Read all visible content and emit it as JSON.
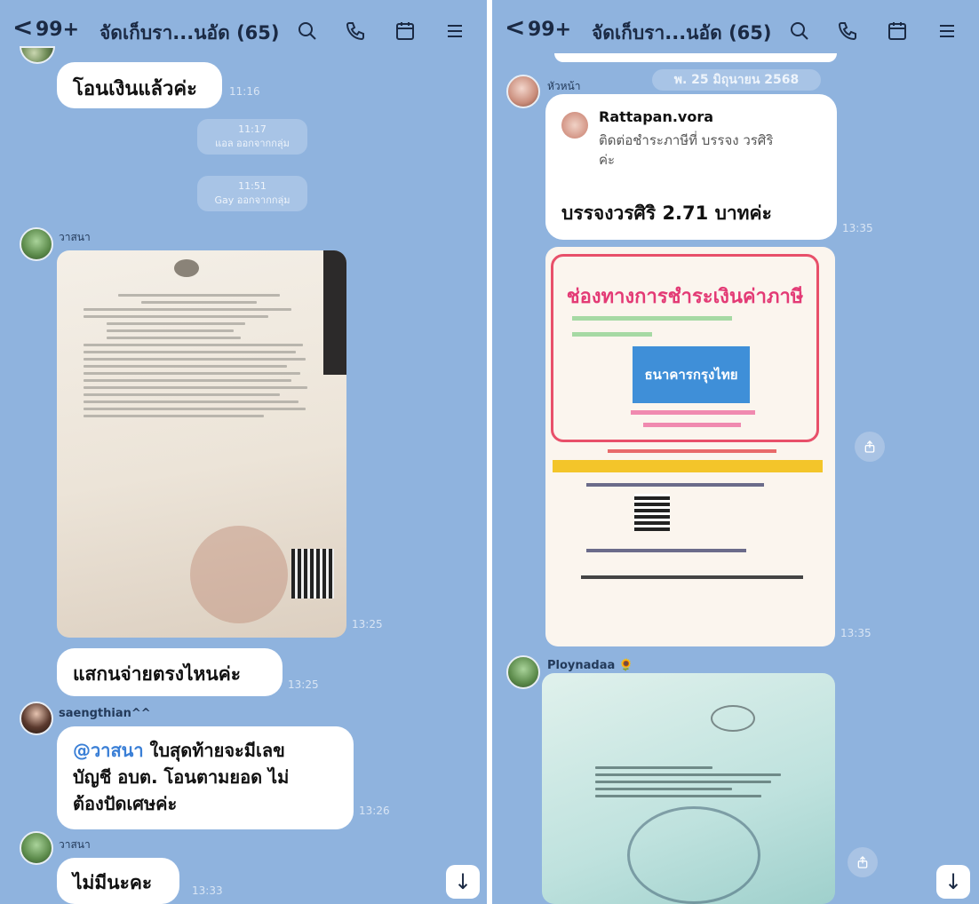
{
  "header": {
    "back_glyph": "<",
    "unread_count": "99+",
    "title": "จัดเก็บรา...นอัด (65)",
    "icons": [
      "search-icon",
      "phone-icon",
      "calendar-icon",
      "menu-icon"
    ]
  },
  "left": {
    "messages": [
      {
        "text": "โอนเงินแล้วค่ะ",
        "time": "11:16"
      },
      {
        "system_time": "11:17",
        "system_text": "แอล ออกจากกลุ่ม"
      },
      {
        "system_time": "11:51",
        "system_text": "Gay ออกจากกลุ่ม"
      },
      {
        "sender": "วาสนา",
        "photo_time": "13:25"
      },
      {
        "text": "แสกนจ่ายตรงไหนค่ะ",
        "time": "13:25"
      },
      {
        "sender": "saengthian^^",
        "mention": "@วาสนา",
        "text_line1": "ใบสุดท้ายจะมีเลข",
        "text_line2": "บัญชี อบต. โอนตามยอด ไม่",
        "text_line3": "ต้องปัดเศษค่ะ",
        "time": "13:26"
      },
      {
        "sender": "วาสนา",
        "text": "ไม่มีนะคะ",
        "time": "13:33"
      }
    ],
    "scroll_down_glyph": "↓"
  },
  "right": {
    "date_chip": "พ. 25 มิถุนายน 2568",
    "messages": [
      {
        "sender": "หัวหน้า",
        "reply_name": "Rattapan.vora",
        "reply_text_line1": "ติดต่อชำระภาษีที่ บรรจง วรศิริ",
        "reply_text_line2": "ค่ะ",
        "text": "บรรจงวรศิริ 2.71 บาทค่ะ",
        "time": "13:35"
      },
      {
        "photo_title": "ช่องทางการชำระเงินค่าภาษี",
        "bank_name": "ธนาคารกรุงไทย",
        "photo_time": "13:35"
      },
      {
        "sender": "Ploynadaa",
        "sender_emoji": "🌻"
      }
    ],
    "scroll_down_glyph": "↓"
  },
  "colors": {
    "chat_background": "#8fb3de",
    "bubble": "#ffffff",
    "header_text": "#1b2a44",
    "mention": "#3a7fd6",
    "tax_title": "#e33a75"
  }
}
